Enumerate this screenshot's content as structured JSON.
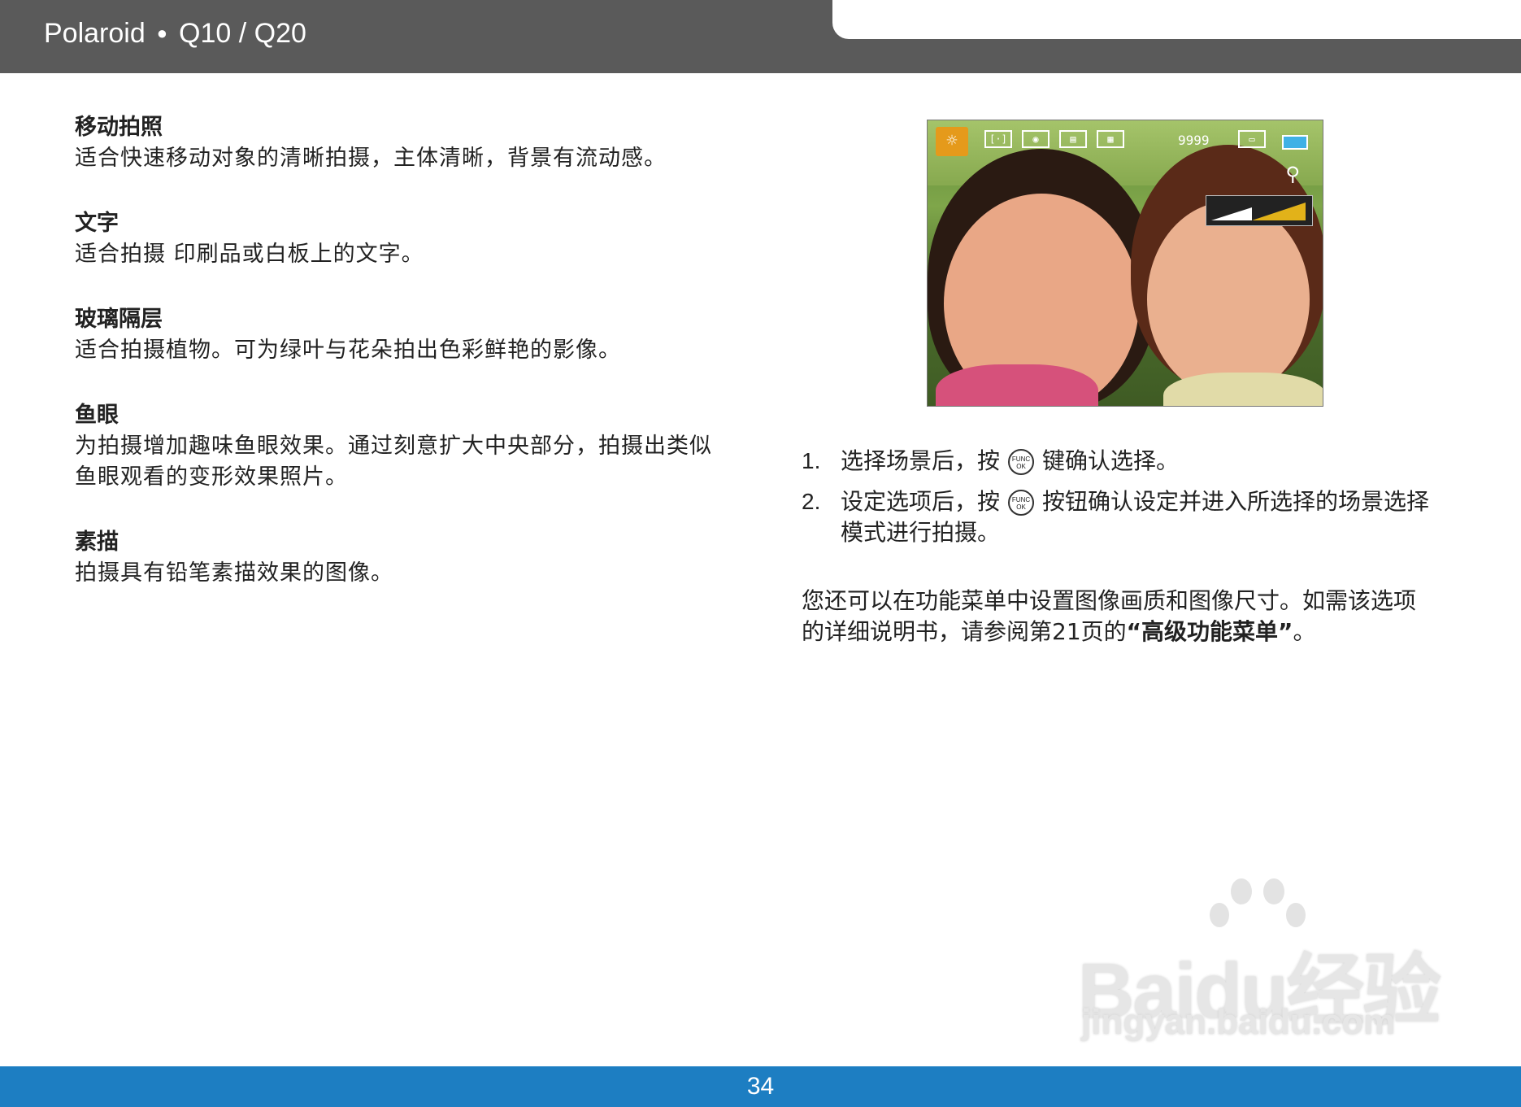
{
  "header": {
    "brand": "Polaroid",
    "separator": "●",
    "model": "Q10 / Q20"
  },
  "sections": [
    {
      "title": "移动拍照",
      "body": "适合快速移动对象的清晰拍摄，主体清晰，背景有流动感。"
    },
    {
      "title": "文字",
      "body": "适合拍摄 印刷品或白板上的文字。"
    },
    {
      "title": "玻璃隔层",
      "body": "适合拍摄植物。可为绿叶与花朵拍出色彩鲜艳的影像。"
    },
    {
      "title": "鱼眼",
      "body": "为拍摄增加趣味鱼眼效果。通过刻意扩大中央部分，拍摄出类似鱼眼观看的变形效果照片。"
    },
    {
      "title": "素描",
      "body": "拍摄具有铅笔素描效果的图像。"
    }
  ],
  "photo_hud": {
    "scene_icon": "sun-icon",
    "shots_remaining": "9999",
    "battery_color": "#3fb1e6",
    "scene_color": "#e59a1b"
  },
  "steps": [
    {
      "num": "1.",
      "before": "选择场景后，按",
      "button": "FUNC OK",
      "after": "键确认选择。"
    },
    {
      "num": "2.",
      "before": "设定选项后，按",
      "button": "FUNC OK",
      "after": "按钮确认设定并进入所选择的场景选择模式进行拍摄。"
    }
  ],
  "note": {
    "text_before": "您还可以在功能菜单中设置图像画质和图像尺寸。如需该选项的详细说明书，请参阅第21页的",
    "link": "“高级功能菜单”",
    "text_after": "。"
  },
  "watermark": {
    "main": "Baidu经验",
    "sub": "jingyan.baidu.com"
  },
  "footer": {
    "page_number": "34",
    "color": "#1d7ec2"
  }
}
